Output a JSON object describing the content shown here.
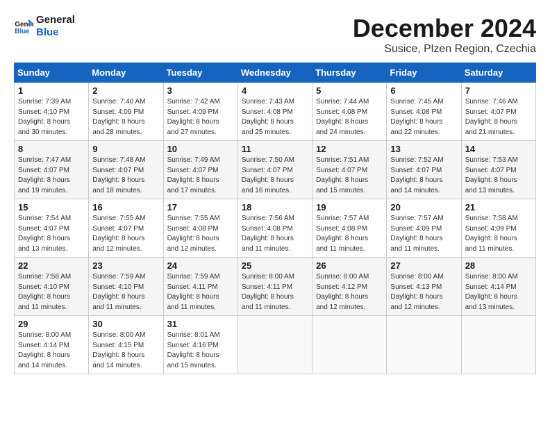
{
  "logo": {
    "line1": "General",
    "line2": "Blue"
  },
  "title": "December 2024",
  "location": "Susice, Plzen Region, Czechia",
  "days_header": [
    "Sunday",
    "Monday",
    "Tuesday",
    "Wednesday",
    "Thursday",
    "Friday",
    "Saturday"
  ],
  "weeks": [
    [
      {
        "day": "1",
        "sunrise": "7:39 AM",
        "sunset": "4:10 PM",
        "daylight": "8 hours and 30 minutes."
      },
      {
        "day": "2",
        "sunrise": "7:40 AM",
        "sunset": "4:09 PM",
        "daylight": "8 hours and 28 minutes."
      },
      {
        "day": "3",
        "sunrise": "7:42 AM",
        "sunset": "4:09 PM",
        "daylight": "8 hours and 27 minutes."
      },
      {
        "day": "4",
        "sunrise": "7:43 AM",
        "sunset": "4:08 PM",
        "daylight": "8 hours and 25 minutes."
      },
      {
        "day": "5",
        "sunrise": "7:44 AM",
        "sunset": "4:08 PM",
        "daylight": "8 hours and 24 minutes."
      },
      {
        "day": "6",
        "sunrise": "7:45 AM",
        "sunset": "4:08 PM",
        "daylight": "8 hours and 22 minutes."
      },
      {
        "day": "7",
        "sunrise": "7:46 AM",
        "sunset": "4:07 PM",
        "daylight": "8 hours and 21 minutes."
      }
    ],
    [
      {
        "day": "8",
        "sunrise": "7:47 AM",
        "sunset": "4:07 PM",
        "daylight": "8 hours and 19 minutes."
      },
      {
        "day": "9",
        "sunrise": "7:48 AM",
        "sunset": "4:07 PM",
        "daylight": "8 hours and 18 minutes."
      },
      {
        "day": "10",
        "sunrise": "7:49 AM",
        "sunset": "4:07 PM",
        "daylight": "8 hours and 17 minutes."
      },
      {
        "day": "11",
        "sunrise": "7:50 AM",
        "sunset": "4:07 PM",
        "daylight": "8 hours and 16 minutes."
      },
      {
        "day": "12",
        "sunrise": "7:51 AM",
        "sunset": "4:07 PM",
        "daylight": "8 hours and 15 minutes."
      },
      {
        "day": "13",
        "sunrise": "7:52 AM",
        "sunset": "4:07 PM",
        "daylight": "8 hours and 14 minutes."
      },
      {
        "day": "14",
        "sunrise": "7:53 AM",
        "sunset": "4:07 PM",
        "daylight": "8 hours and 13 minutes."
      }
    ],
    [
      {
        "day": "15",
        "sunrise": "7:54 AM",
        "sunset": "4:07 PM",
        "daylight": "8 hours and 13 minutes."
      },
      {
        "day": "16",
        "sunrise": "7:55 AM",
        "sunset": "4:07 PM",
        "daylight": "8 hours and 12 minutes."
      },
      {
        "day": "17",
        "sunrise": "7:55 AM",
        "sunset": "4:08 PM",
        "daylight": "8 hours and 12 minutes."
      },
      {
        "day": "18",
        "sunrise": "7:56 AM",
        "sunset": "4:08 PM",
        "daylight": "8 hours and 11 minutes."
      },
      {
        "day": "19",
        "sunrise": "7:57 AM",
        "sunset": "4:08 PM",
        "daylight": "8 hours and 11 minutes."
      },
      {
        "day": "20",
        "sunrise": "7:57 AM",
        "sunset": "4:09 PM",
        "daylight": "8 hours and 11 minutes."
      },
      {
        "day": "21",
        "sunrise": "7:58 AM",
        "sunset": "4:09 PM",
        "daylight": "8 hours and 11 minutes."
      }
    ],
    [
      {
        "day": "22",
        "sunrise": "7:58 AM",
        "sunset": "4:10 PM",
        "daylight": "8 hours and 11 minutes."
      },
      {
        "day": "23",
        "sunrise": "7:59 AM",
        "sunset": "4:10 PM",
        "daylight": "8 hours and 11 minutes."
      },
      {
        "day": "24",
        "sunrise": "7:59 AM",
        "sunset": "4:11 PM",
        "daylight": "8 hours and 11 minutes."
      },
      {
        "day": "25",
        "sunrise": "8:00 AM",
        "sunset": "4:11 PM",
        "daylight": "8 hours and 11 minutes."
      },
      {
        "day": "26",
        "sunrise": "8:00 AM",
        "sunset": "4:12 PM",
        "daylight": "8 hours and 12 minutes."
      },
      {
        "day": "27",
        "sunrise": "8:00 AM",
        "sunset": "4:13 PM",
        "daylight": "8 hours and 12 minutes."
      },
      {
        "day": "28",
        "sunrise": "8:00 AM",
        "sunset": "4:14 PM",
        "daylight": "8 hours and 13 minutes."
      }
    ],
    [
      {
        "day": "29",
        "sunrise": "8:00 AM",
        "sunset": "4:14 PM",
        "daylight": "8 hours and 14 minutes."
      },
      {
        "day": "30",
        "sunrise": "8:00 AM",
        "sunset": "4:15 PM",
        "daylight": "8 hours and 14 minutes."
      },
      {
        "day": "31",
        "sunrise": "8:01 AM",
        "sunset": "4:16 PM",
        "daylight": "8 hours and 15 minutes."
      },
      null,
      null,
      null,
      null
    ]
  ]
}
